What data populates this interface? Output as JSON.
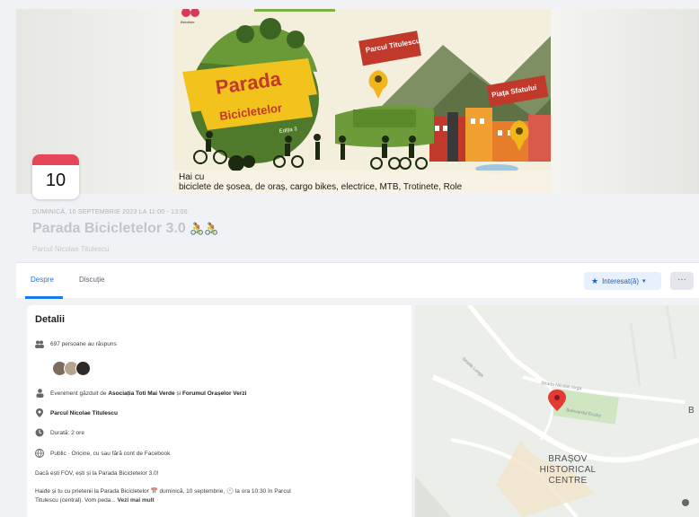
{
  "poster": {
    "logo_text": "Bicicliște",
    "title_line1": "Parada",
    "title_line2": "Bicicletelor",
    "title_line3": "Ediția 3",
    "pin1_label": "Parcul Titulescu",
    "pin2_label": "Piața Sfatului",
    "caption_line1": "Hai cu",
    "caption_line2": "biciclete de șosea, de oraș, cargo bikes, electrice, MTB, Trotinete, Role"
  },
  "event": {
    "day": "10",
    "date_line": "DUMINICĂ, 10 SEPTEMBRIE 2023 LA 11:00 - 13:00",
    "title": "Parada Bicicletelor 3.0",
    "title_emoji": "🚴🚴",
    "place": "Parcul Nicolae Titulescu"
  },
  "tabs": [
    {
      "label": "Despre"
    },
    {
      "label": "Discuție"
    }
  ],
  "actions": {
    "interested_label": "Interesat(ă)",
    "more_label": "···"
  },
  "details": {
    "heading": "Detalii",
    "responded": "697 persoane au răspuns",
    "organizer_prefix": "Eveniment găzduit de",
    "organizer_1": "Asociația Toti Mai Verde",
    "organizer_join": "și",
    "organizer_2": "Forumul Orașelor Verzi",
    "location": "Parcul Nicolae Titulescu",
    "duration": "Durată: 2 ore",
    "visibility": "Public · Oricine, cu sau fără cont de Facebook",
    "desc_line1": "Dacă ești FOV, ești și la Parada Bicicletelor 3.0!",
    "desc_line2": "Haide și tu cu prietenii la Parada Bicicletelor 📅 duminică, 10 septembrie, 🕚 la ora 10:30 în Parcul",
    "desc_line3_text": "Titulescu (central). Vom peda...",
    "see_more": "Vezi mai mult"
  },
  "map": {
    "street_1": "Strada Lunga",
    "street_2": "Strada Nicolae Iorga",
    "street_3": "Bulevardul Eroilor",
    "area_label_1": "BRAȘOV",
    "area_label_2": "HISTORICAL",
    "area_label_3": "CENTRE",
    "edge_label": "B"
  },
  "colors": {
    "accent": "#1877f2",
    "date_red": "#e5465a",
    "map_pin": "#e53935"
  }
}
